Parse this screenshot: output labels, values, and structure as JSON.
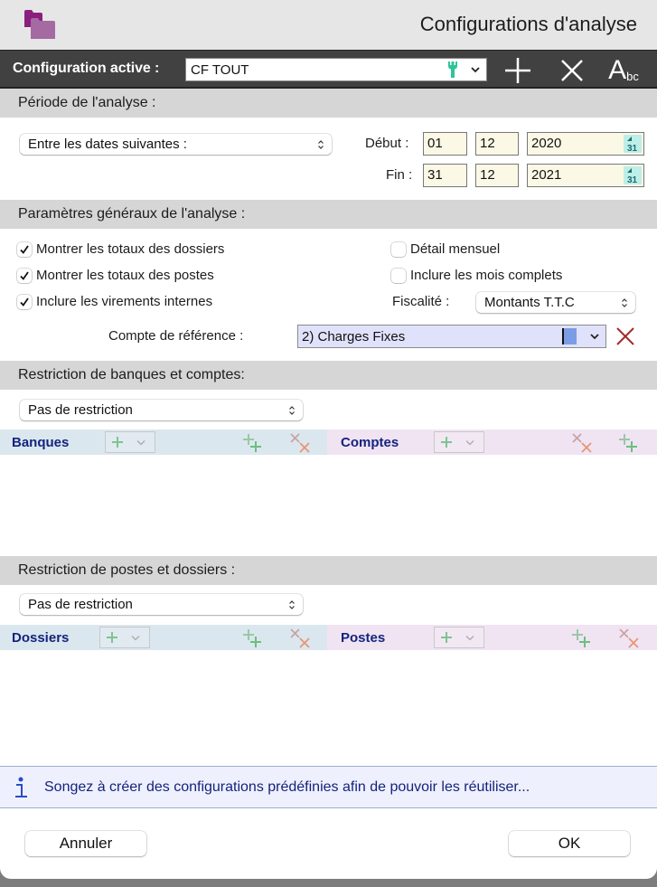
{
  "window": {
    "title": "Configurations d'analyse"
  },
  "toolbar": {
    "label": "Configuration active :",
    "config_value": "CF TOUT",
    "add_tooltip": "add",
    "delete_tooltip": "delete",
    "rename_big": "A",
    "rename_small": "bc"
  },
  "period": {
    "header": "Période de l'analyse :",
    "mode": "Entre les dates suivantes :",
    "start_label": "Début :",
    "end_label": "Fin :",
    "start": {
      "day": "01",
      "month": "12",
      "year": "2020"
    },
    "end": {
      "day": "31",
      "month": "12",
      "year": "2021"
    },
    "calendar_icon_text": "31"
  },
  "general": {
    "header": "Paramètres généraux de l'analyse :",
    "checkboxes": [
      {
        "label": "Montrer les totaux des dossiers",
        "checked": true
      },
      {
        "label": "Montrer les totaux des postes",
        "checked": true
      },
      {
        "label": "Inclure les virements internes",
        "checked": true
      },
      {
        "label": "Détail mensuel",
        "checked": false
      },
      {
        "label": "Inclure les mois complets",
        "checked": false
      }
    ],
    "fiscal_label": "Fiscalité :",
    "fiscal_value": "Montants T.T.C",
    "ref_label": "Compte de référence :",
    "ref_value": "2) Charges Fixes",
    "ref_color": "#7d9ce6"
  },
  "banks": {
    "header": "Restriction de banques et comptes:",
    "restriction": "Pas de restriction",
    "left_title": "Banques",
    "right_title": "Comptes"
  },
  "posts": {
    "header": "Restriction de postes et dossiers :",
    "restriction": "Pas de restriction",
    "left_title": "Dossiers",
    "right_title": "Postes"
  },
  "info": {
    "text": "Songez à créer des configurations prédéfinies afin de pouvoir les réutiliser..."
  },
  "buttons": {
    "cancel": "Annuler",
    "ok": "OK"
  },
  "colors": {
    "title_accent": "#14237e",
    "add_green": "#6bbf7f",
    "delete_red": "#d98a70",
    "clear_red": "#a52a2a",
    "wrench_teal": "#2ec49a"
  }
}
